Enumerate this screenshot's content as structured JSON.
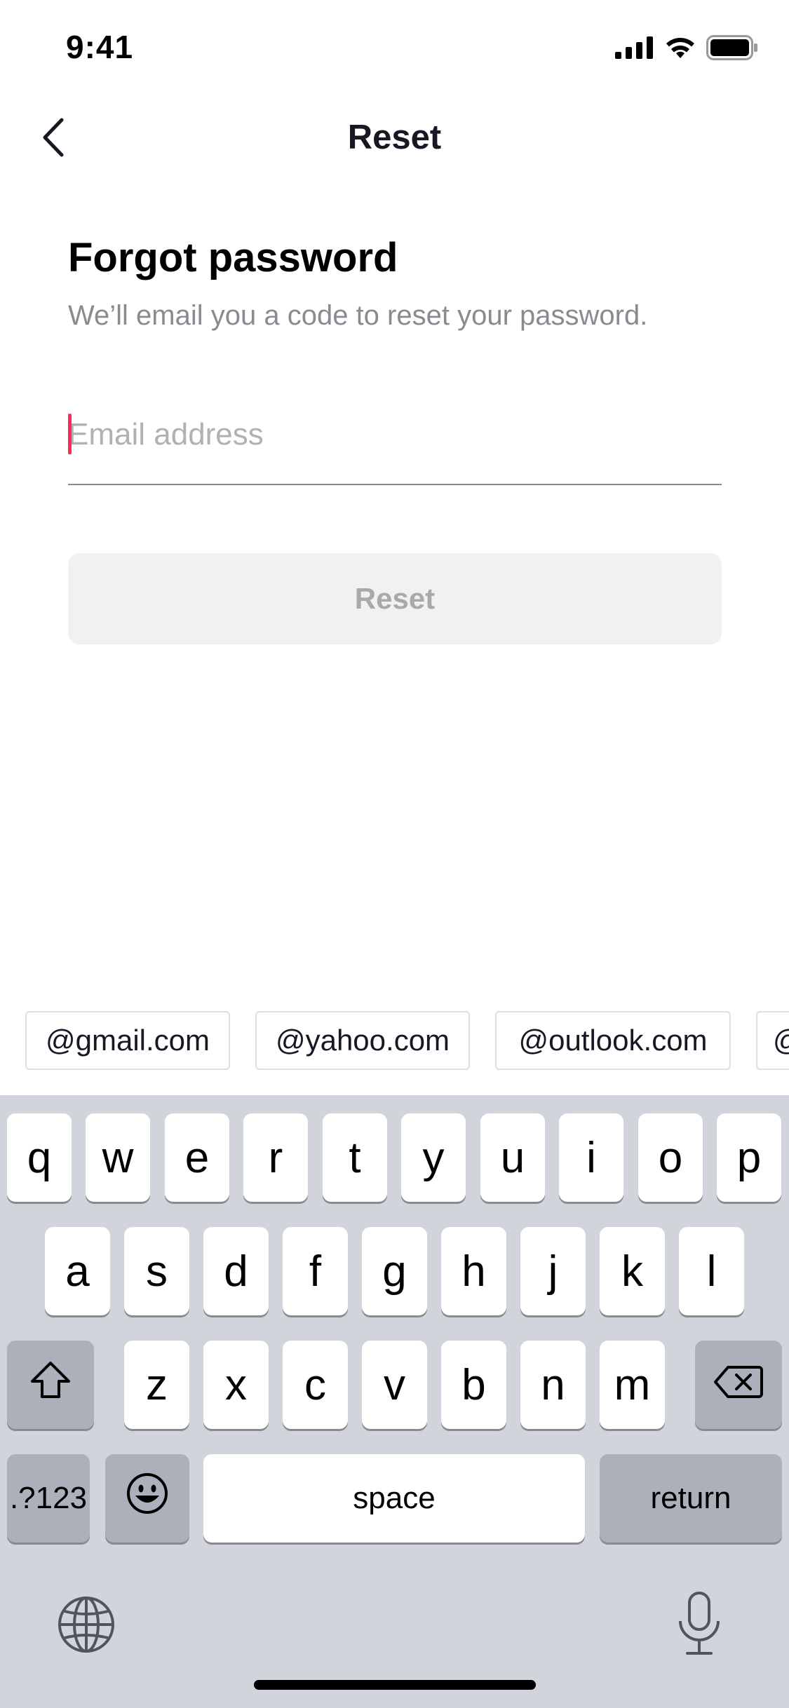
{
  "status_bar": {
    "time": "9:41"
  },
  "nav": {
    "title": "Reset"
  },
  "content": {
    "heading": "Forgot password",
    "subheading": "We’ll email you a code to reset your password.",
    "email_placeholder": "Email address",
    "email_value": "",
    "reset_label": "Reset"
  },
  "suggestions": [
    "@gmail.com",
    "@yahoo.com",
    "@outlook.com",
    "@"
  ],
  "keyboard": {
    "row1": [
      "q",
      "w",
      "e",
      "r",
      "t",
      "y",
      "u",
      "i",
      "o",
      "p"
    ],
    "row2": [
      "a",
      "s",
      "d",
      "f",
      "g",
      "h",
      "j",
      "k",
      "l"
    ],
    "row3": [
      "z",
      "x",
      "c",
      "v",
      "b",
      "n",
      "m"
    ],
    "numbers_label": ".?123",
    "space_label": "space",
    "return_label": "return"
  },
  "colors": {
    "accent_caret": "#fe2c55",
    "disabled_button_bg": "#f1f1f2",
    "keyboard_bg": "#d1d4db"
  }
}
